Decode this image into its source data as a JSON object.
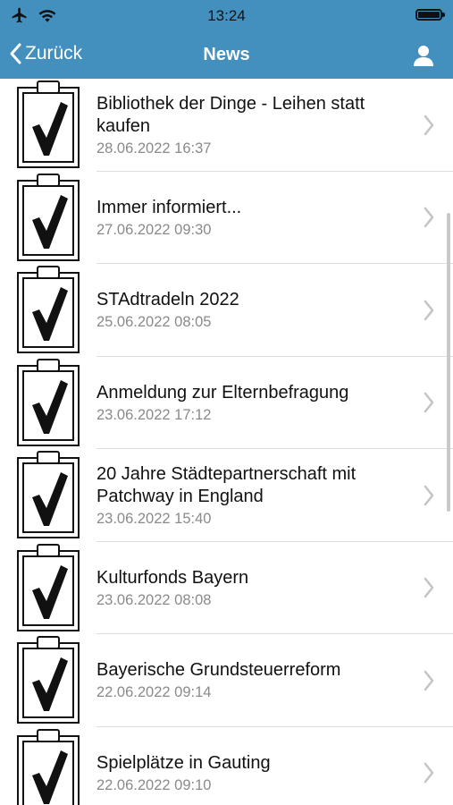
{
  "status_bar": {
    "time": "13:24",
    "icons": [
      "airplane-icon",
      "wifi-icon",
      "battery-icon"
    ]
  },
  "nav": {
    "back_label": "Zurück",
    "title": "News",
    "right_icon": "user-icon"
  },
  "colors": {
    "accent": "#4390bf",
    "title_text": "#111111",
    "date_text": "#8a8a8a"
  },
  "news": [
    {
      "title": "Bibliothek der Dinge - Leihen statt kaufen",
      "date": "28.06.2022 16:37"
    },
    {
      "title": "Immer informiert...",
      "date": "27.06.2022 09:30"
    },
    {
      "title": "STAdtradeln 2022",
      "date": "25.06.2022 08:05"
    },
    {
      "title": "Anmeldung zur Elternbefragung",
      "date": "23.06.2022 17:12"
    },
    {
      "title": "20 Jahre Städtepartnerschaft mit Patchway in England",
      "date": "23.06.2022 15:40"
    },
    {
      "title": "Kulturfonds Bayern",
      "date": "23.06.2022 08:08"
    },
    {
      "title": "Bayerische Grundsteuerreform",
      "date": "22.06.2022 09:14"
    },
    {
      "title": "Spielplätze in Gauting",
      "date": "22.06.2022 09:10"
    }
  ]
}
